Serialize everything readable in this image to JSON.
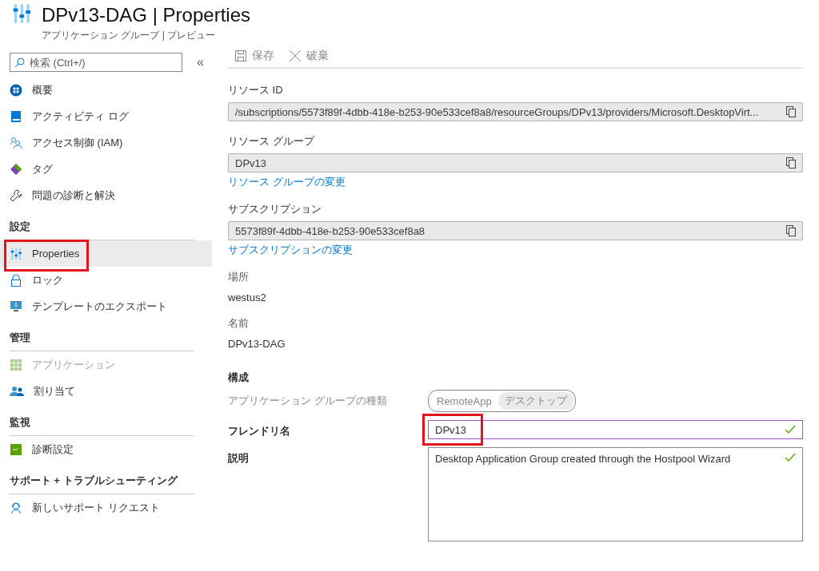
{
  "header": {
    "title": "DPv13-DAG | Properties",
    "subtitle": "アプリケーション グループ | プレビュー"
  },
  "sidebar": {
    "search": {
      "placeholder": "検索 (Ctrl+/)"
    },
    "collapse": "«",
    "sections": [
      {
        "items": [
          {
            "label": "概要",
            "selected": false,
            "disabled": false,
            "highlighted": false
          },
          {
            "label": "アクティビティ ログ",
            "selected": false,
            "disabled": false,
            "highlighted": false
          },
          {
            "label": "アクセス制御 (IAM)",
            "selected": false,
            "disabled": false,
            "highlighted": false
          },
          {
            "label": "タグ",
            "selected": false,
            "disabled": false,
            "highlighted": false
          },
          {
            "label": "問題の診断と解決",
            "selected": false,
            "disabled": false,
            "highlighted": false
          }
        ]
      },
      {
        "heading": "設定",
        "items": [
          {
            "label": "Properties",
            "selected": true,
            "disabled": false,
            "highlighted": true
          },
          {
            "label": "ロック",
            "selected": false,
            "disabled": false,
            "highlighted": false
          },
          {
            "label": "テンプレートのエクスポート",
            "selected": false,
            "disabled": false,
            "highlighted": false
          }
        ]
      },
      {
        "heading": "管理",
        "items": [
          {
            "label": "アプリケーション",
            "selected": false,
            "disabled": true,
            "highlighted": false
          },
          {
            "label": "割り当て",
            "selected": false,
            "disabled": false,
            "highlighted": false
          }
        ]
      },
      {
        "heading": "監視",
        "items": [
          {
            "label": "診断設定",
            "selected": false,
            "disabled": false,
            "highlighted": false
          }
        ]
      },
      {
        "heading": "サポート + トラブルシューティング",
        "items": [
          {
            "label": "新しいサポート リクエスト",
            "selected": false,
            "disabled": false,
            "highlighted": false
          }
        ]
      }
    ]
  },
  "toolbar": [
    {
      "label": "保存",
      "disabled": true
    },
    {
      "label": "破棄",
      "disabled": true
    }
  ],
  "properties": [
    {
      "kind": "readonly",
      "label": "リソース ID",
      "value": "/subscriptions/5573f89f-4dbb-418e-b253-90e533cef8a8/resourceGroups/DPv13/providers/Microsoft.DesktopVirt..."
    },
    {
      "kind": "readonly",
      "label": "リソース グループ",
      "value": "DPv13",
      "link": "リソース グループの変更"
    },
    {
      "kind": "readonly",
      "label": "サブスクリプション",
      "value": "5573f89f-4dbb-418e-b253-90e533cef8a8",
      "link": "サブスクリプションの変更"
    },
    {
      "kind": "plain",
      "label": "場所",
      "value": "westus2"
    },
    {
      "kind": "plain",
      "label": "名前",
      "value": "DPv13-DAG"
    }
  ],
  "configuration": {
    "heading": "構成",
    "group_type": {
      "label": "アプリケーション グループの種類",
      "disabled": true,
      "options": [
        {
          "label": "RemoteApp",
          "selected": false
        },
        {
          "label": "デスクトップ",
          "selected": true
        }
      ]
    },
    "friendly_name": {
      "label": "フレンドリ名",
      "value": "DPv13",
      "valid": true,
      "highlighted": true
    },
    "description": {
      "label": "説明",
      "value": "Desktop Application Group created through the Hostpool Wizard",
      "valid": true
    }
  }
}
